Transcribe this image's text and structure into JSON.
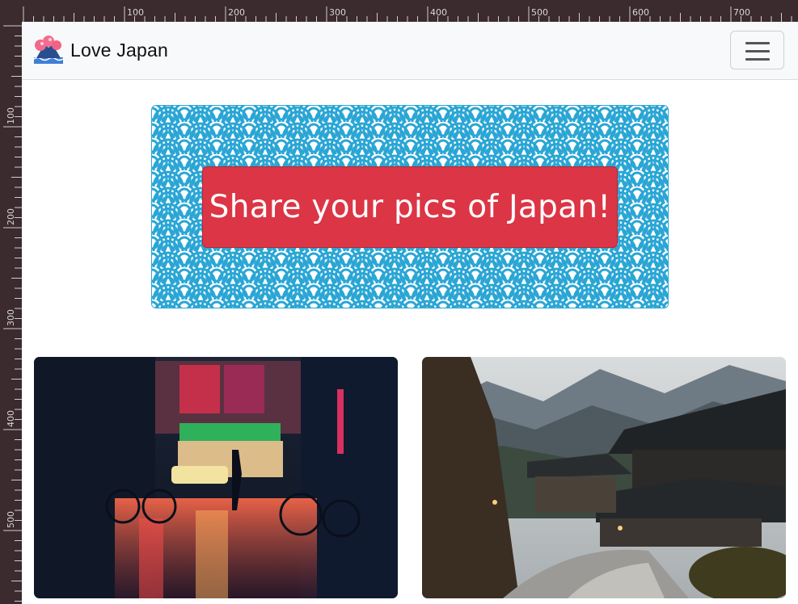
{
  "ruler": {
    "top_labels": [
      "100",
      "200",
      "300",
      "400",
      "500",
      "600",
      "700"
    ],
    "left_labels": [
      "100",
      "200",
      "300",
      "400",
      "500"
    ]
  },
  "navbar": {
    "brand_text": "Love Japan",
    "brand_icon": "mount-fuji-icon"
  },
  "hero": {
    "cta_label": "Share your pics of Japan!",
    "pattern": "seigaiha-wave-pattern",
    "pattern_color": "#2aa6d5",
    "cta_color": "#dc3545"
  },
  "gallery": {
    "cards": [
      {
        "image": "rainy-night-street-photo"
      },
      {
        "image": "mountain-village-photo"
      }
    ]
  }
}
